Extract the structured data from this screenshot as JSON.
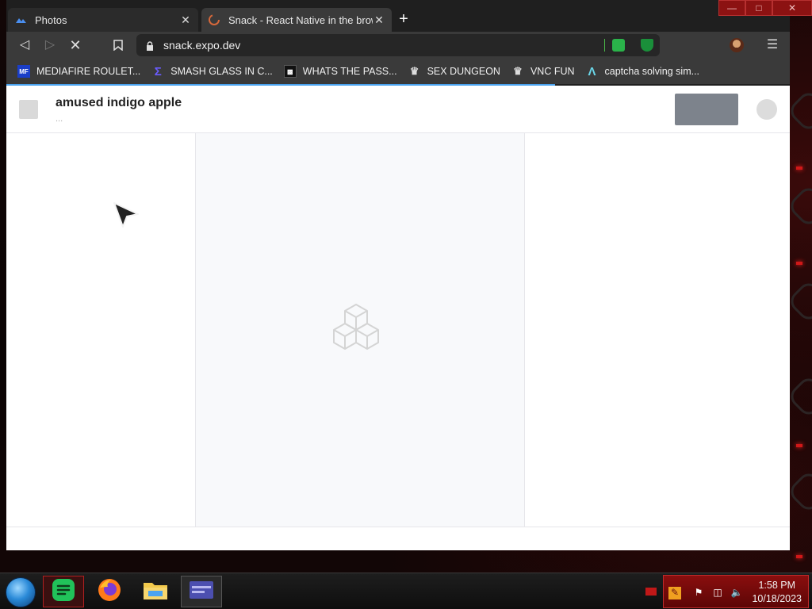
{
  "browser": {
    "tabs": [
      {
        "title": "Photos",
        "state": "inactive",
        "icon": "cloud-photos-icon"
      },
      {
        "title": "Snack - React Native in the browser",
        "state": "active",
        "icon": "snack-loading-icon"
      }
    ],
    "new_tab_label": "+",
    "url": "snack.expo.dev",
    "bookmarks": [
      {
        "label": "MEDIAFIRE ROULET...",
        "icon": "mft-icon"
      },
      {
        "label": "SMASH GLASS IN C...",
        "icon": "sigma-icon"
      },
      {
        "label": "WHATS THE PASS...",
        "icon": "terminal-icon"
      },
      {
        "label": "SEX DUNGEON",
        "icon": "puzzle-icon"
      },
      {
        "label": "VNC FUN",
        "icon": "puzzle-icon"
      },
      {
        "label": "captcha solving sim...",
        "icon": "lambda-icon"
      }
    ],
    "load_progress": 0.7
  },
  "page": {
    "project_title": "amused indigo apple",
    "project_subtitle": "..."
  },
  "taskbar": {
    "time": "1:58 PM",
    "date": "10/18/2023",
    "apps": [
      "notes-app-icon",
      "firefox-icon",
      "file-explorer-icon",
      "browser-window-icon"
    ]
  },
  "colors": {
    "accent_load": "#4aa3f0",
    "tray_red": "#8a0e0e",
    "save_button": "#7d838c"
  }
}
